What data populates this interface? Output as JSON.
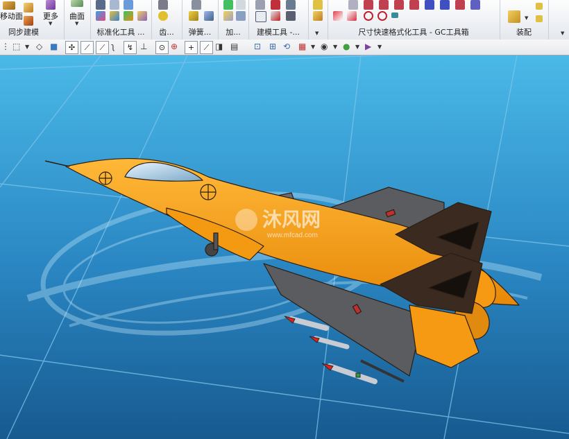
{
  "ribbon": {
    "groups": [
      {
        "id": "sync",
        "label": "同步建模"
      },
      {
        "id": "std",
        "label": "标准化工具 ..."
      },
      {
        "id": "gear",
        "label": "齿..."
      },
      {
        "id": "spring",
        "label": "弹簧..."
      },
      {
        "id": "add",
        "label": "加..."
      },
      {
        "id": "build",
        "label": "建模工具 -..."
      },
      {
        "id": "dim",
        "label": "尺寸快速格式化工具 - GC工具箱"
      },
      {
        "id": "asm",
        "label": "装配"
      }
    ],
    "buttons": {
      "move_face": "移动面",
      "more": "更多",
      "surface": "曲面"
    }
  },
  "watermark": {
    "title": "沐风网",
    "url": "www.mfcad.com"
  },
  "colors": {
    "aircraft_body": "#f59a12",
    "aircraft_dark": "#3a2a20",
    "missile_red": "#e0201a",
    "sky_top": "#48b8e6",
    "sky_bottom": "#1a5f92"
  }
}
